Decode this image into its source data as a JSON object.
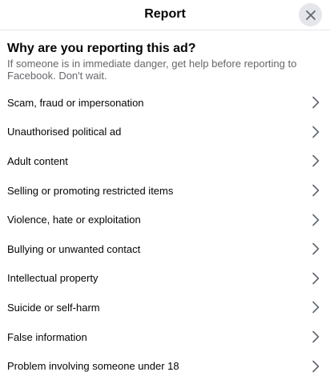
{
  "header": {
    "title": "Report",
    "close_icon": "close-icon"
  },
  "prompt": {
    "question": "Why are you reporting this ad?",
    "subtext": "If someone is in immediate danger, get help before reporting to Facebook. Don't wait."
  },
  "options": [
    {
      "label": "Scam, fraud or impersonation"
    },
    {
      "label": "Unauthorised political ad"
    },
    {
      "label": "Adult content"
    },
    {
      "label": "Selling or promoting restricted items"
    },
    {
      "label": "Violence, hate or exploitation"
    },
    {
      "label": "Bullying or unwanted contact"
    },
    {
      "label": "Intellectual property"
    },
    {
      "label": "Suicide or self-harm"
    },
    {
      "label": "False information"
    },
    {
      "label": "Problem involving someone under 18"
    }
  ],
  "icons": {
    "option_arrow": "chevron-right-icon"
  },
  "colors": {
    "text_primary": "#050505",
    "text_secondary": "#65676b",
    "close_button_bg": "#e4e6eb",
    "divider": "#e4e6eb"
  }
}
